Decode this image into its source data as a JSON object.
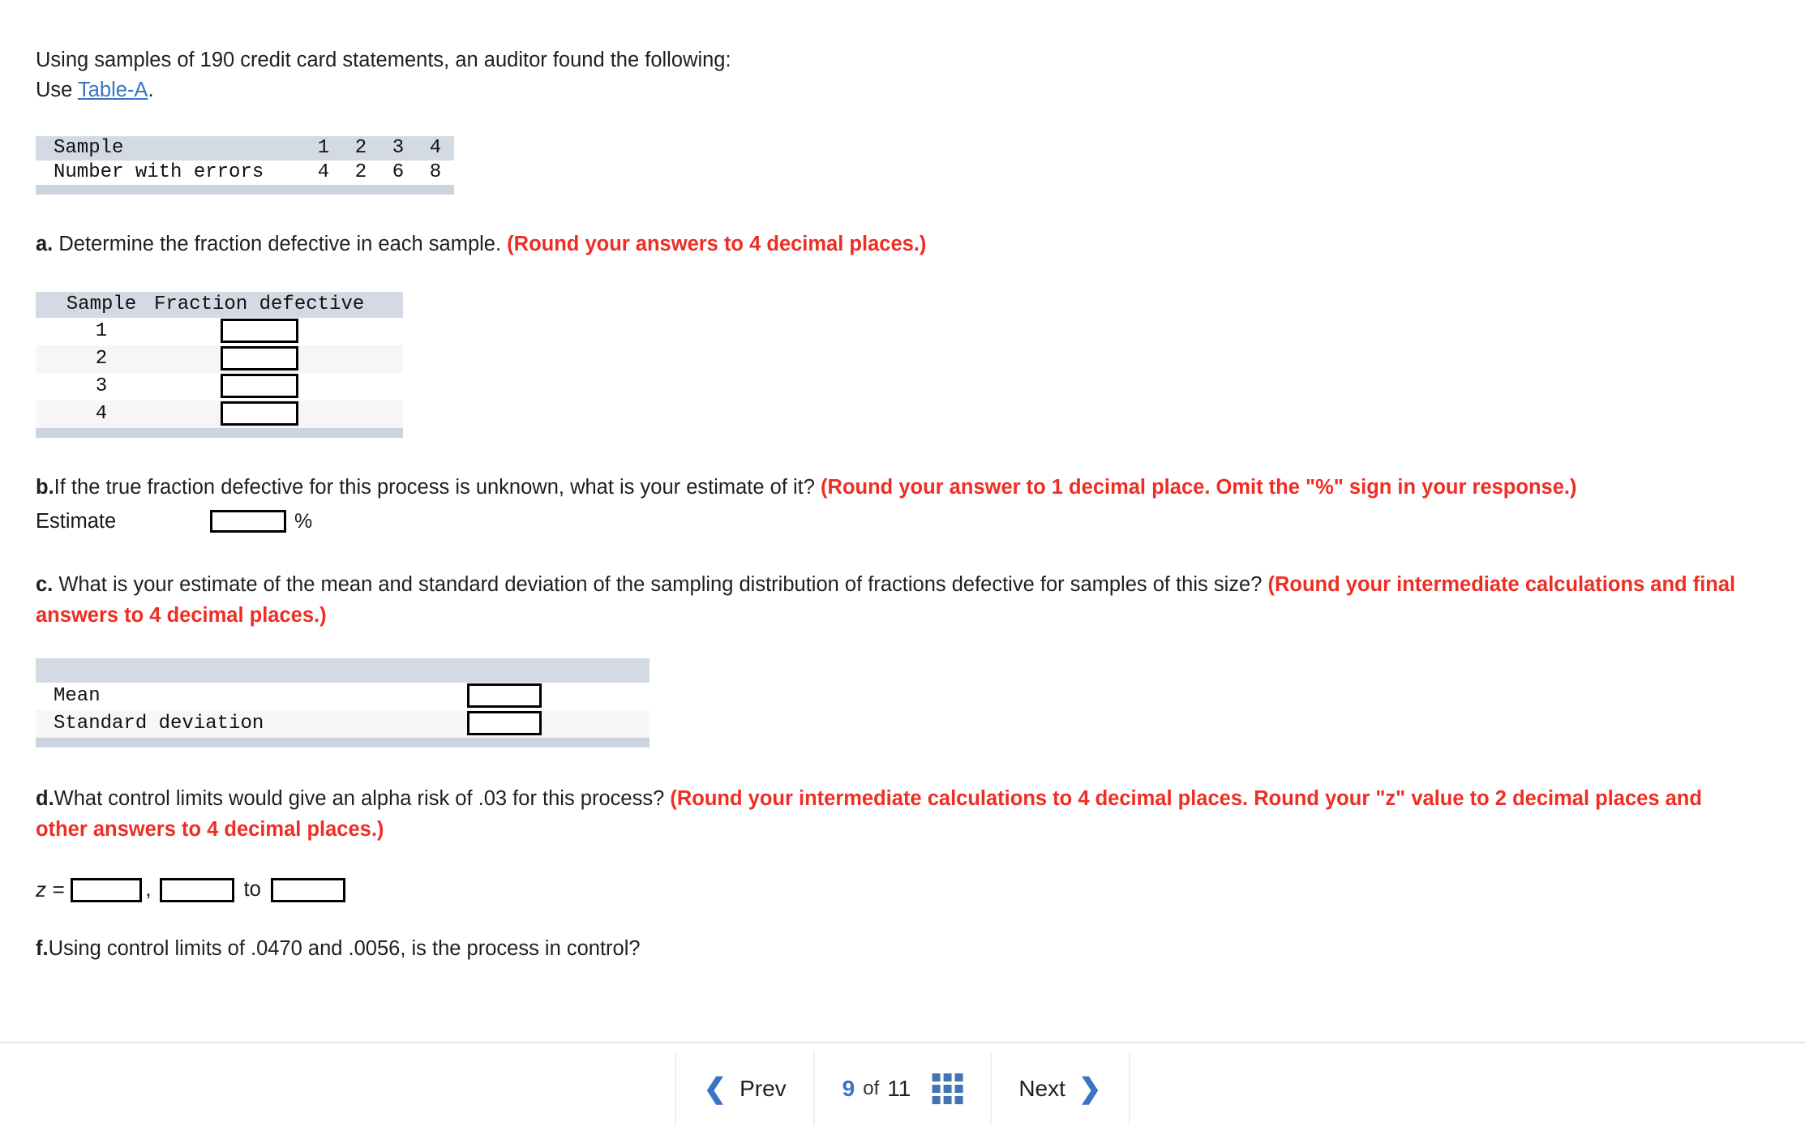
{
  "intro": {
    "line1": "Using samples of 190 credit card statements, an auditor found the following:",
    "line2_pre": "Use ",
    "link": "Table-A",
    "line2_post": "."
  },
  "data_table": {
    "row_labels": [
      "Sample",
      "Number with errors"
    ],
    "samples": [
      "1",
      "2",
      "3",
      "4"
    ],
    "errors": [
      "4",
      "2",
      "6",
      "8"
    ]
  },
  "questions": {
    "a": {
      "label": "a.",
      "text": " Determine the fraction defective in each sample. ",
      "note": "(Round your answers to 4 decimal places.)"
    },
    "b": {
      "label": "b.",
      "text": "If the true fraction defective for this process is unknown, what is your estimate of it? ",
      "note": "(Round your answer to 1 decimal place. Omit the \"%\" sign in your response.)",
      "estimate_label": "Estimate",
      "estimate_value": "",
      "percent_sign": "%"
    },
    "c": {
      "label": "c.",
      "text": " What is your estimate of the mean and standard deviation of the sampling distribution of fractions defective for samples of this size? ",
      "note": "(Round your intermediate calculations and final answers to 4 decimal places.)"
    },
    "d": {
      "label": "d.",
      "text": "What control limits would give an alpha risk of .03 for this process? ",
      "note": "(Round your intermediate calculations to 4 decimal places. Round your \"z\" value to 2 decimal places and other answers to 4 decimal places.)",
      "z_label": "z =",
      "z_value": "",
      "comma": ",",
      "lower_value": "",
      "to_label": "to",
      "upper_value": ""
    },
    "f": {
      "label": "f.",
      "text": "Using control limits of .0470 and .0056, is the process in control?"
    }
  },
  "fraction_table": {
    "headers": [
      "Sample",
      "Fraction defective"
    ],
    "rows": [
      {
        "sample": "1",
        "value": ""
      },
      {
        "sample": "2",
        "value": ""
      },
      {
        "sample": "3",
        "value": ""
      },
      {
        "sample": "4",
        "value": ""
      }
    ]
  },
  "stats_table": {
    "header": "",
    "rows": [
      {
        "label": "Mean",
        "value": ""
      },
      {
        "label": "Standard deviation",
        "value": ""
      }
    ]
  },
  "footer": {
    "prev_label": "Prev",
    "prev_icon": "chevron-left-icon",
    "page_current": "9",
    "page_of": "of",
    "page_total": "11",
    "grid_icon": "grid-menu-icon",
    "next_label": "Next",
    "next_icon": "chevron-right-icon"
  },
  "colors": {
    "link": "#3b73c4",
    "accent": "#4373b4",
    "note_red": "#ee2e24",
    "table_header": "#d4dae4",
    "table_footer": "#ccd4e0",
    "row_alt": "#f6f6f6"
  }
}
